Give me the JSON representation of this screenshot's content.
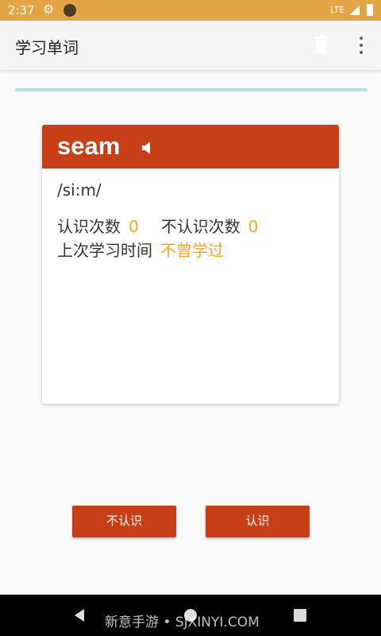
{
  "status_bar": {
    "time": "2:37",
    "network": "LTE"
  },
  "app_bar": {
    "title": "学习单词",
    "delete_icon": "trash-icon",
    "menu_icon": "more-vert-icon"
  },
  "progress": {
    "value": 0
  },
  "card": {
    "word": "seam",
    "phonetic": "/si:m/",
    "known_label": "认识次数",
    "known_count": "0",
    "unknown_label": "不认识次数",
    "unknown_count": "0",
    "last_study_label": "上次学习时间",
    "last_study_value": "不曾学过",
    "header_color": "#c73e17",
    "accent_color": "#f5a623"
  },
  "buttons": {
    "unknown": "不认识",
    "known": "认识"
  },
  "watermark": "新意手游 • SJXINYI.COM"
}
